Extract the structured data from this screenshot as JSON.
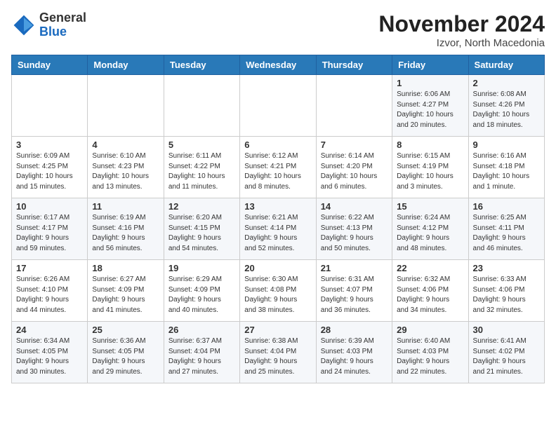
{
  "logo": {
    "general": "General",
    "blue": "Blue"
  },
  "title": "November 2024",
  "subtitle": "Izvor, North Macedonia",
  "days_of_week": [
    "Sunday",
    "Monday",
    "Tuesday",
    "Wednesday",
    "Thursday",
    "Friday",
    "Saturday"
  ],
  "weeks": [
    [
      {
        "day": "",
        "info": ""
      },
      {
        "day": "",
        "info": ""
      },
      {
        "day": "",
        "info": ""
      },
      {
        "day": "",
        "info": ""
      },
      {
        "day": "",
        "info": ""
      },
      {
        "day": "1",
        "info": "Sunrise: 6:06 AM\nSunset: 4:27 PM\nDaylight: 10 hours\nand 20 minutes."
      },
      {
        "day": "2",
        "info": "Sunrise: 6:08 AM\nSunset: 4:26 PM\nDaylight: 10 hours\nand 18 minutes."
      }
    ],
    [
      {
        "day": "3",
        "info": "Sunrise: 6:09 AM\nSunset: 4:25 PM\nDaylight: 10 hours\nand 15 minutes."
      },
      {
        "day": "4",
        "info": "Sunrise: 6:10 AM\nSunset: 4:23 PM\nDaylight: 10 hours\nand 13 minutes."
      },
      {
        "day": "5",
        "info": "Sunrise: 6:11 AM\nSunset: 4:22 PM\nDaylight: 10 hours\nand 11 minutes."
      },
      {
        "day": "6",
        "info": "Sunrise: 6:12 AM\nSunset: 4:21 PM\nDaylight: 10 hours\nand 8 minutes."
      },
      {
        "day": "7",
        "info": "Sunrise: 6:14 AM\nSunset: 4:20 PM\nDaylight: 10 hours\nand 6 minutes."
      },
      {
        "day": "8",
        "info": "Sunrise: 6:15 AM\nSunset: 4:19 PM\nDaylight: 10 hours\nand 3 minutes."
      },
      {
        "day": "9",
        "info": "Sunrise: 6:16 AM\nSunset: 4:18 PM\nDaylight: 10 hours\nand 1 minute."
      }
    ],
    [
      {
        "day": "10",
        "info": "Sunrise: 6:17 AM\nSunset: 4:17 PM\nDaylight: 9 hours\nand 59 minutes."
      },
      {
        "day": "11",
        "info": "Sunrise: 6:19 AM\nSunset: 4:16 PM\nDaylight: 9 hours\nand 56 minutes."
      },
      {
        "day": "12",
        "info": "Sunrise: 6:20 AM\nSunset: 4:15 PM\nDaylight: 9 hours\nand 54 minutes."
      },
      {
        "day": "13",
        "info": "Sunrise: 6:21 AM\nSunset: 4:14 PM\nDaylight: 9 hours\nand 52 minutes."
      },
      {
        "day": "14",
        "info": "Sunrise: 6:22 AM\nSunset: 4:13 PM\nDaylight: 9 hours\nand 50 minutes."
      },
      {
        "day": "15",
        "info": "Sunrise: 6:24 AM\nSunset: 4:12 PM\nDaylight: 9 hours\nand 48 minutes."
      },
      {
        "day": "16",
        "info": "Sunrise: 6:25 AM\nSunset: 4:11 PM\nDaylight: 9 hours\nand 46 minutes."
      }
    ],
    [
      {
        "day": "17",
        "info": "Sunrise: 6:26 AM\nSunset: 4:10 PM\nDaylight: 9 hours\nand 44 minutes."
      },
      {
        "day": "18",
        "info": "Sunrise: 6:27 AM\nSunset: 4:09 PM\nDaylight: 9 hours\nand 41 minutes."
      },
      {
        "day": "19",
        "info": "Sunrise: 6:29 AM\nSunset: 4:09 PM\nDaylight: 9 hours\nand 40 minutes."
      },
      {
        "day": "20",
        "info": "Sunrise: 6:30 AM\nSunset: 4:08 PM\nDaylight: 9 hours\nand 38 minutes."
      },
      {
        "day": "21",
        "info": "Sunrise: 6:31 AM\nSunset: 4:07 PM\nDaylight: 9 hours\nand 36 minutes."
      },
      {
        "day": "22",
        "info": "Sunrise: 6:32 AM\nSunset: 4:06 PM\nDaylight: 9 hours\nand 34 minutes."
      },
      {
        "day": "23",
        "info": "Sunrise: 6:33 AM\nSunset: 4:06 PM\nDaylight: 9 hours\nand 32 minutes."
      }
    ],
    [
      {
        "day": "24",
        "info": "Sunrise: 6:34 AM\nSunset: 4:05 PM\nDaylight: 9 hours\nand 30 minutes."
      },
      {
        "day": "25",
        "info": "Sunrise: 6:36 AM\nSunset: 4:05 PM\nDaylight: 9 hours\nand 29 minutes."
      },
      {
        "day": "26",
        "info": "Sunrise: 6:37 AM\nSunset: 4:04 PM\nDaylight: 9 hours\nand 27 minutes."
      },
      {
        "day": "27",
        "info": "Sunrise: 6:38 AM\nSunset: 4:04 PM\nDaylight: 9 hours\nand 25 minutes."
      },
      {
        "day": "28",
        "info": "Sunrise: 6:39 AM\nSunset: 4:03 PM\nDaylight: 9 hours\nand 24 minutes."
      },
      {
        "day": "29",
        "info": "Sunrise: 6:40 AM\nSunset: 4:03 PM\nDaylight: 9 hours\nand 22 minutes."
      },
      {
        "day": "30",
        "info": "Sunrise: 6:41 AM\nSunset: 4:02 PM\nDaylight: 9 hours\nand 21 minutes."
      }
    ]
  ]
}
